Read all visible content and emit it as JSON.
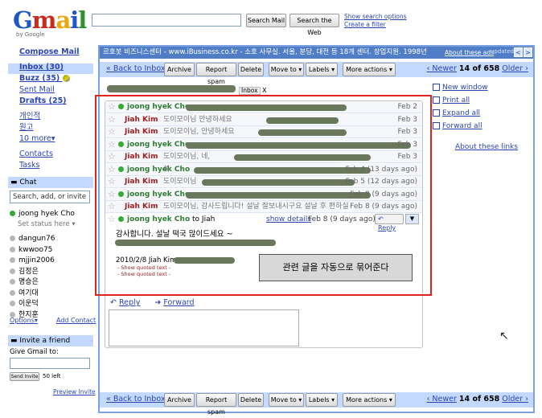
{
  "header": {
    "logo": "Gmail",
    "logo_sub": "by Google",
    "search_mail": "Search Mail",
    "search_web": "Search the Web",
    "show_options": "Show search options",
    "create_filter": "Create a filter"
  },
  "nav": {
    "compose": "Compose Mail",
    "items": [
      "Inbox (30)",
      "Buzz (35)",
      "Sent Mail",
      "Drafts (25)",
      "개인적",
      "원고",
      "10 more▾"
    ],
    "contacts": "Contacts",
    "tasks": "Tasks"
  },
  "chat": {
    "title": "Chat",
    "search_placeholder": "Search, add, or invite",
    "me": "joong hyek Cho",
    "status": "Set status here",
    "contacts": [
      "dangun76",
      "kwwoo75",
      "mjjin2006",
      "김정은",
      "명승은",
      "여기대",
      "이운덕",
      "한지훈"
    ],
    "options": "Options▾",
    "add_contact": "Add Contact"
  },
  "invite": {
    "title": "Invite a friend",
    "label": "Give Gmail to:",
    "send": "Send Invite",
    "left": "50 left",
    "preview": "Preview Invite"
  },
  "ad": {
    "text": "르호봇 비즈니스센터 - www.iBusiness.co.kr - 소호 사무실. 서울, 분당, 대전 등 18개 센터. 창업지원. 1998년",
    "about": "About these ads",
    "updated": "updated",
    "prev": "<",
    "next": ">"
  },
  "toolbar": {
    "back": "« Back to Inbox",
    "archive": "Archive",
    "spam": "Report spam",
    "delete": "Delete",
    "move": "Move to ▾",
    "labels": "Labels ▾",
    "more": "More actions ▾",
    "newer": "‹ Newer",
    "count": "14 of 658",
    "older": "Older ›"
  },
  "thread": {
    "label": "Inbox",
    "label_x": "X",
    "side": [
      "New window",
      "Print all",
      "Expand all",
      "Forward all"
    ],
    "about_links": "About these links",
    "rows": [
      {
        "sender": "joong hyek Cho",
        "snippet": "",
        "date": "Feb 2"
      },
      {
        "sender": "Jiah Kim",
        "snippet": "도이모이님 안녕하세요",
        "date": "Feb 3"
      },
      {
        "sender": "Jiah Kim",
        "snippet": "도이모이님, 안녕하세요",
        "date": "Feb 3"
      },
      {
        "sender": "joong hyek Cho",
        "snippet": "",
        "date": "Feb 3"
      },
      {
        "sender": "Jiah Kim",
        "snippet": "도이모이님, 네,",
        "date": "Feb 3"
      },
      {
        "sender": "joong hyek Cho",
        "snippet": "쏙",
        "date": "Feb 4 (13 days ago)"
      },
      {
        "sender": "Jiah Kim",
        "snippet": "도이모이님",
        "date": "Feb 5 (12 days ago)"
      },
      {
        "sender": "joong hyek Cho",
        "snippet": "",
        "date": "Feb 8 (9 days ago)"
      },
      {
        "sender": "Jiah Kim",
        "snippet": "도이모이님, 감사드립니다! 설날 잘보내시구요 설날 후 편하실",
        "date": "Feb 8 (9 days ago)"
      }
    ],
    "open": {
      "sender": "joong hyek Cho",
      "to": "to Jiah",
      "details": "show details",
      "date": "Feb 8 (9 days ago)",
      "reply": "Reply",
      "body": "감사합니다. 설날 떡국 많이드세요 ~",
      "sig": "2010/2/8 Jiah Kim",
      "quoted": "- Show quoted text -"
    },
    "reply": "Reply",
    "forward": "Forward",
    "callout": "관련 글을 자동으로 묶어준다"
  }
}
